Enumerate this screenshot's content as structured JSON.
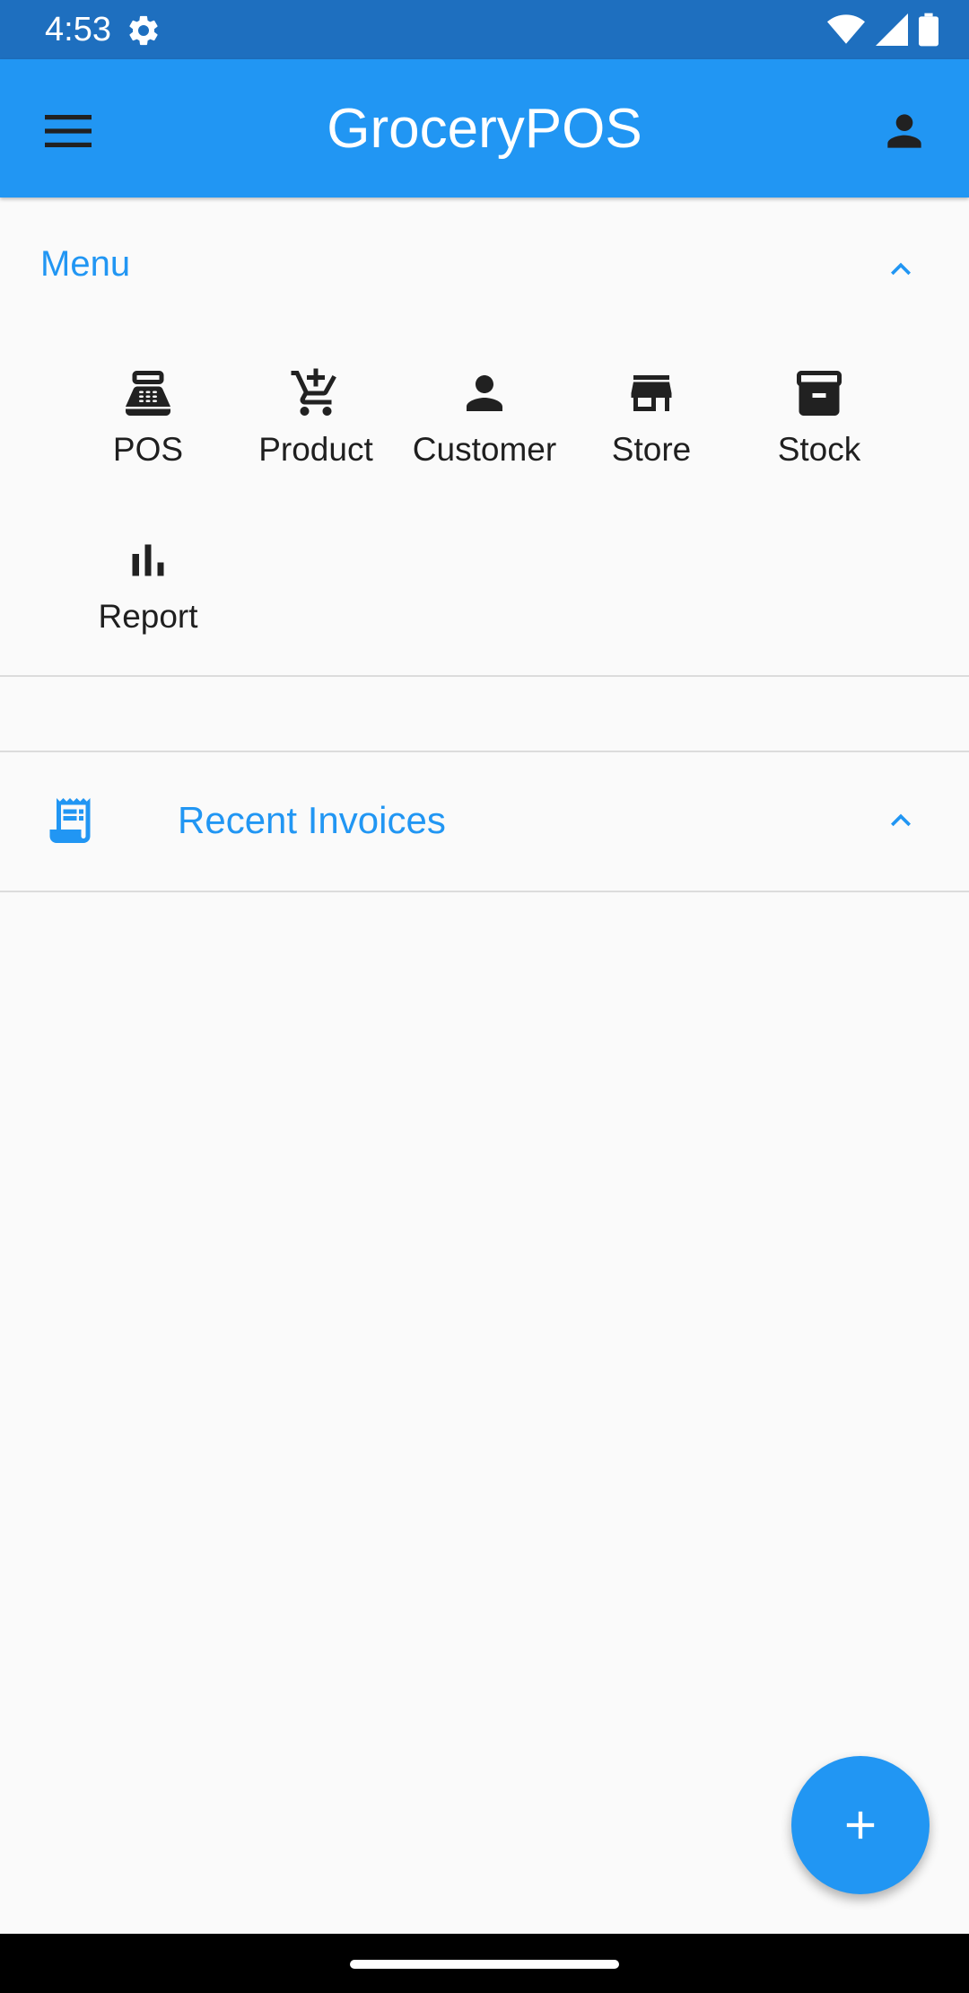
{
  "status_bar": {
    "time": "4:53",
    "icons": [
      "settings-gear-icon",
      "wifi-icon",
      "signal-icon",
      "battery-icon"
    ],
    "color": "#1e6fbf"
  },
  "app_bar": {
    "title": "GroceryPOS",
    "menu_icon": "hamburger-menu-icon",
    "profile_icon": "person-icon",
    "color": "#2196f3"
  },
  "menu_section": {
    "title": "Menu",
    "expanded": true,
    "items": [
      {
        "label": "POS",
        "icon": "cash-register-icon"
      },
      {
        "label": "Product",
        "icon": "cart-add-icon"
      },
      {
        "label": "Customer",
        "icon": "person-icon"
      },
      {
        "label": "Store",
        "icon": "store-icon"
      },
      {
        "label": "Stock",
        "icon": "archive-box-icon"
      },
      {
        "label": "Report",
        "icon": "bar-chart-icon"
      }
    ]
  },
  "invoices_section": {
    "title": "Recent Invoices",
    "icon": "receipt-icon",
    "expanded": true
  },
  "fab": {
    "icon": "plus-icon"
  },
  "colors": {
    "accent": "#2196f3",
    "background": "#fafafa",
    "divider": "#dcdcdc",
    "icon": "#212121"
  }
}
